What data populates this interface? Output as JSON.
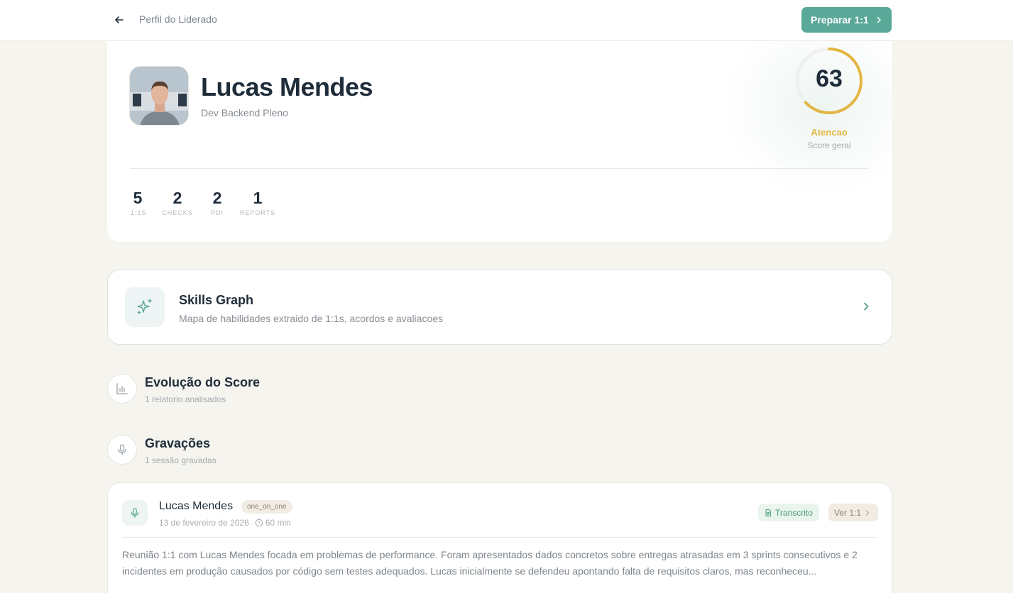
{
  "topbar": {
    "title": "Perfil do Liderado",
    "prepare_label": "Preparar 1:1"
  },
  "profile": {
    "name": "Lucas Mendes",
    "role": "Dev Backend Pleno",
    "score": {
      "value": "63",
      "percent": 63,
      "status": "Atencao",
      "caption": "Score geral",
      "color": "#e3b544"
    },
    "stats": [
      {
        "value": "5",
        "label": "1:1s"
      },
      {
        "value": "2",
        "label": "Checks"
      },
      {
        "value": "2",
        "label": "PDI"
      },
      {
        "value": "1",
        "label": "Reports"
      }
    ]
  },
  "skills": {
    "title": "Skills Graph",
    "subtitle": "Mapa de habilidades extraido de 1:1s, acordos e avaliacoes"
  },
  "evolution": {
    "title": "Evolução do Score",
    "subtitle": "1 relatorio analisados"
  },
  "recordings": {
    "title": "Gravações",
    "subtitle": "1 sessão gravadas",
    "items": [
      {
        "name": "Lucas Mendes",
        "type": "one_on_one",
        "date": "13 de fevereiro de 2026",
        "duration": "60 min",
        "transcript_label": "Transcrito",
        "view_label": "Ver 1:1",
        "summary": "Reunião 1:1 com Lucas Mendes focada em problemas de performance. Foram apresentados dados concretos sobre entregas atrasadas em 3 sprints consecutivos e 2 incidentes em produção causados por código sem testes adequados. Lucas inicialmente se defendeu apontando falta de requisitos claros, mas reconheceu..."
      }
    ]
  },
  "colors": {
    "accent": "#5aa898",
    "warning": "#e3b544",
    "background": "#f6f4ef"
  }
}
